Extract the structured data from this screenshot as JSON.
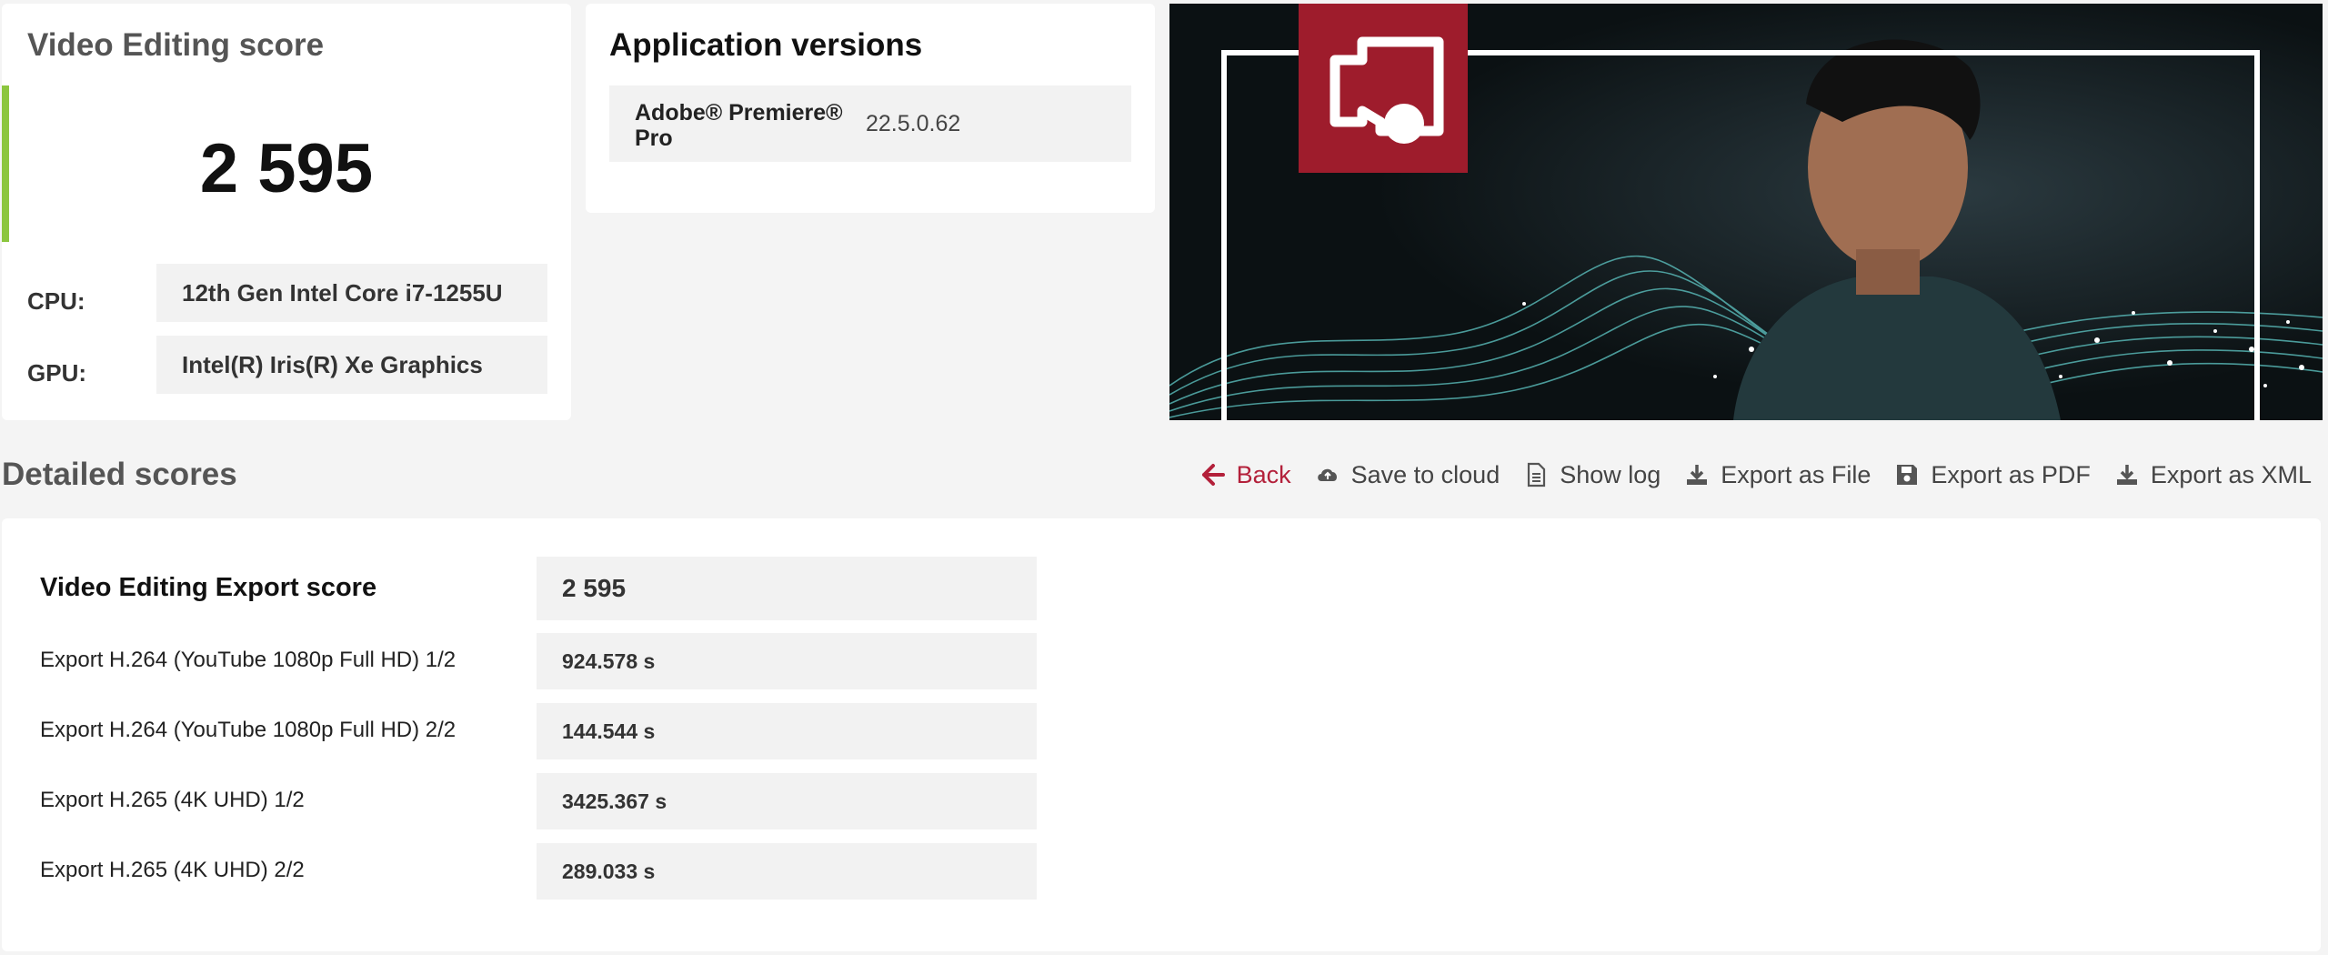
{
  "score_card": {
    "title": "Video Editing score",
    "score": "2 595",
    "cpu_label": "CPU:",
    "cpu_value": "12th Gen Intel Core i7-1255U",
    "gpu_label": "GPU:",
    "gpu_value": "Intel(R) Iris(R) Xe Graphics"
  },
  "app_versions": {
    "title": "Application versions",
    "rows": [
      {
        "name": "Adobe® Premiere® Pro",
        "version": "22.5.0.62"
      }
    ]
  },
  "detailed": {
    "title": "Detailed scores",
    "toolbar": {
      "back": "Back",
      "save_cloud": "Save to cloud",
      "show_log": "Show log",
      "export_file": "Export as File",
      "export_pdf": "Export as PDF",
      "export_xml": "Export as XML"
    },
    "main_label": "Video Editing Export score",
    "main_value": "2 595",
    "rows": [
      {
        "label": "Export H.264 (YouTube 1080p Full HD) 1/2",
        "value": "924.578 s"
      },
      {
        "label": "Export H.264 (YouTube 1080p Full HD) 2/2",
        "value": "144.544 s"
      },
      {
        "label": "Export H.265 (4K UHD) 1/2",
        "value": "3425.367 s"
      },
      {
        "label": "Export H.265 (4K UHD) 2/2",
        "value": "289.033 s"
      }
    ]
  },
  "colors": {
    "accent_green": "#8cc63f",
    "brand_red": "#9e1c2c",
    "back_red": "#b3203a"
  },
  "banner": {
    "icon": "video-camera-icon"
  }
}
